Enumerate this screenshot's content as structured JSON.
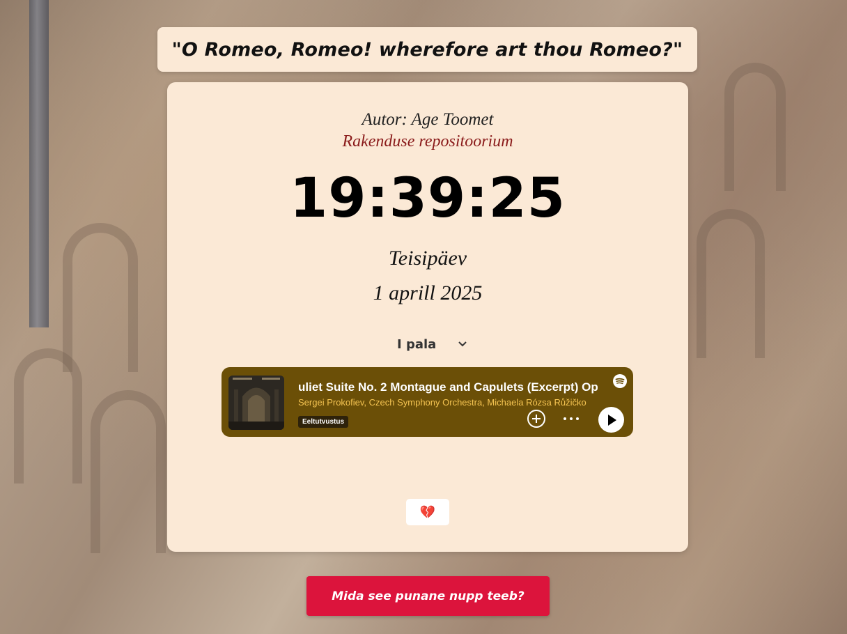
{
  "quote": "\"O Romeo, Romeo! wherefore art thou Romeo?\"",
  "author": "Autor: Age Toomet",
  "repo_link": "Rakenduse repositoorium",
  "clock": {
    "time": "19:39:25",
    "weekday": "Teisipäev",
    "date": "1 aprill 2025"
  },
  "track_select": {
    "selected": "I pala"
  },
  "spotify": {
    "title": "uliet Suite No. 2 Montague and Capulets (Excerpt) Op.",
    "artists": "Sergei Prokofiev, Czech Symphony Orchestra, Michaela Rózsa Růžičko",
    "badge": "Eeltutvustus",
    "background": "#6b4f07",
    "accent": "#f5c452"
  },
  "heart_button": {
    "icon": "broken-heart-icon",
    "glyph": "💔"
  },
  "red_button": {
    "label": "Mida see punane nupp teeb?",
    "color": "#dc143c"
  }
}
